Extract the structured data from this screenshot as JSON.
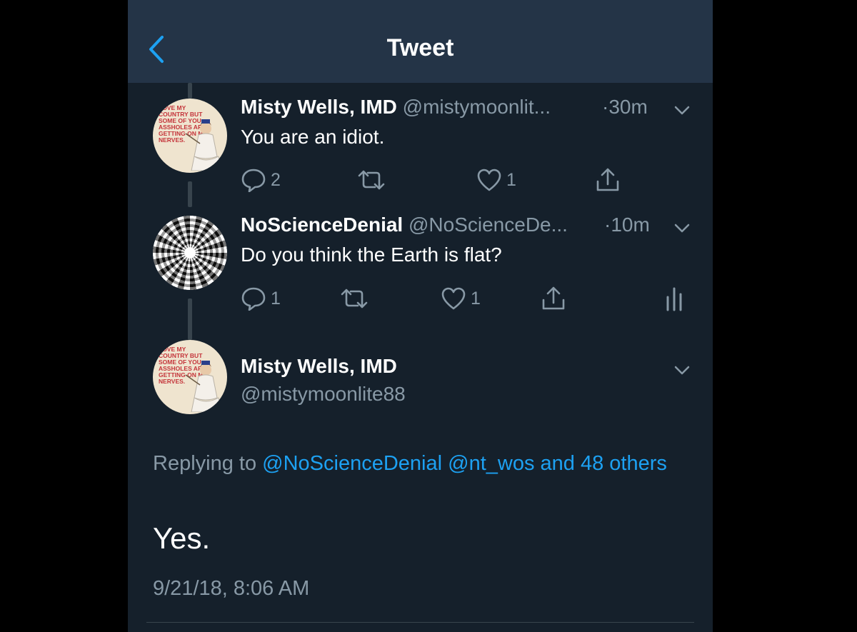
{
  "nav": {
    "title": "Tweet",
    "back_icon": "chevron-left-icon"
  },
  "colors": {
    "background": "#15202b",
    "navbar": "#243447",
    "accent": "#1da1f2",
    "secondary_text": "#8899a6"
  },
  "tweets": [
    {
      "name": "Misty Wells, IMD",
      "handle": "@mistymoonlit...",
      "time": "·30m",
      "text": "You are an idiot.",
      "avatar_text": "Love my country but some of you assholes are getting on my nerves.",
      "replies": "2",
      "retweets": "",
      "likes": "1"
    },
    {
      "name": "NoScienceDenial",
      "handle": "@NoScienceDe...",
      "time": "·10m",
      "text": "Do you think the Earth is flat?",
      "replies": "1",
      "retweets": "",
      "likes": "1"
    }
  ],
  "focused": {
    "name": "Misty Wells, IMD",
    "handle": "@mistymoonlite88",
    "avatar_text": "Love my country but some of you assholes are getting on my nerves.",
    "replying_prefix": "Replying to",
    "replying_mention_1": "@NoScienceDenial",
    "replying_mention_2": "@nt_wos",
    "replying_others": "and 48 others",
    "text": "Yes.",
    "timestamp": "9/21/18, 8:06 AM"
  }
}
